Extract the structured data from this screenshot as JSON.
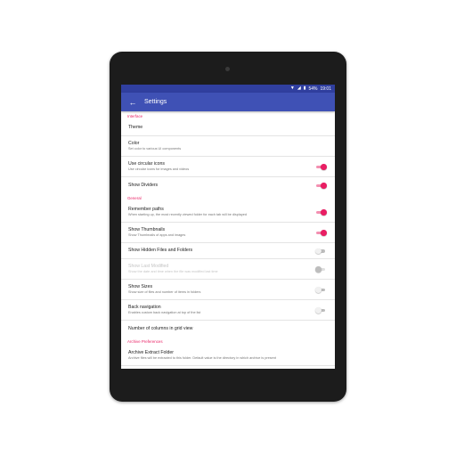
{
  "status_bar": {
    "wifi_icon": "wifi-icon",
    "signal_icon": "signal-icon",
    "battery_icon": "battery-icon",
    "battery": "54%",
    "time": "19:01"
  },
  "app_bar": {
    "back_icon": "arrow-back-icon",
    "title": "Settings"
  },
  "sections": {
    "interface": {
      "header": "Interface",
      "theme": {
        "title": "Theme"
      },
      "color": {
        "title": "Color",
        "summary": "Set color to various UI components"
      },
      "circular_icons": {
        "title": "Use circular icons",
        "summary": "Use circular icons for images and videos",
        "enabled": true
      },
      "show_dividers": {
        "title": "Show Dividers",
        "enabled": true
      }
    },
    "general": {
      "header": "General",
      "remember_paths": {
        "title": "Remember paths",
        "summary": "When starting up, the most recently viewed folder for each tab will be displayed",
        "enabled": true
      },
      "show_thumbnails": {
        "title": "Show Thumbnails",
        "summary": "Show Thumbnails of apps and images",
        "enabled": true
      },
      "show_hidden": {
        "title": "Show Hidden Files and Folders",
        "enabled": false
      },
      "show_last_modified": {
        "title": "Show Last Modified",
        "summary": "Show the date and time when the file was modified last time",
        "enabled": false,
        "disabled": true
      },
      "show_sizes": {
        "title": "Show Sizes",
        "summary": "Show size of files and number of items in folders",
        "enabled": false
      },
      "back_navigation": {
        "title": "Back navigation",
        "summary": "Enables custom back navigation at top of the list",
        "enabled": false
      },
      "grid_columns": {
        "title": "Number of columns in grid view"
      }
    },
    "archive": {
      "header": "Archive Preferences",
      "extract_folder": {
        "title": "Archive Extract Folder",
        "summary": "Archive files will be extracted to this folder. Default value is the directory in which archive is present"
      }
    }
  },
  "colors": {
    "primary": "#3f51b5",
    "primary_dark": "#303f9f",
    "accent": "#e91e63"
  }
}
